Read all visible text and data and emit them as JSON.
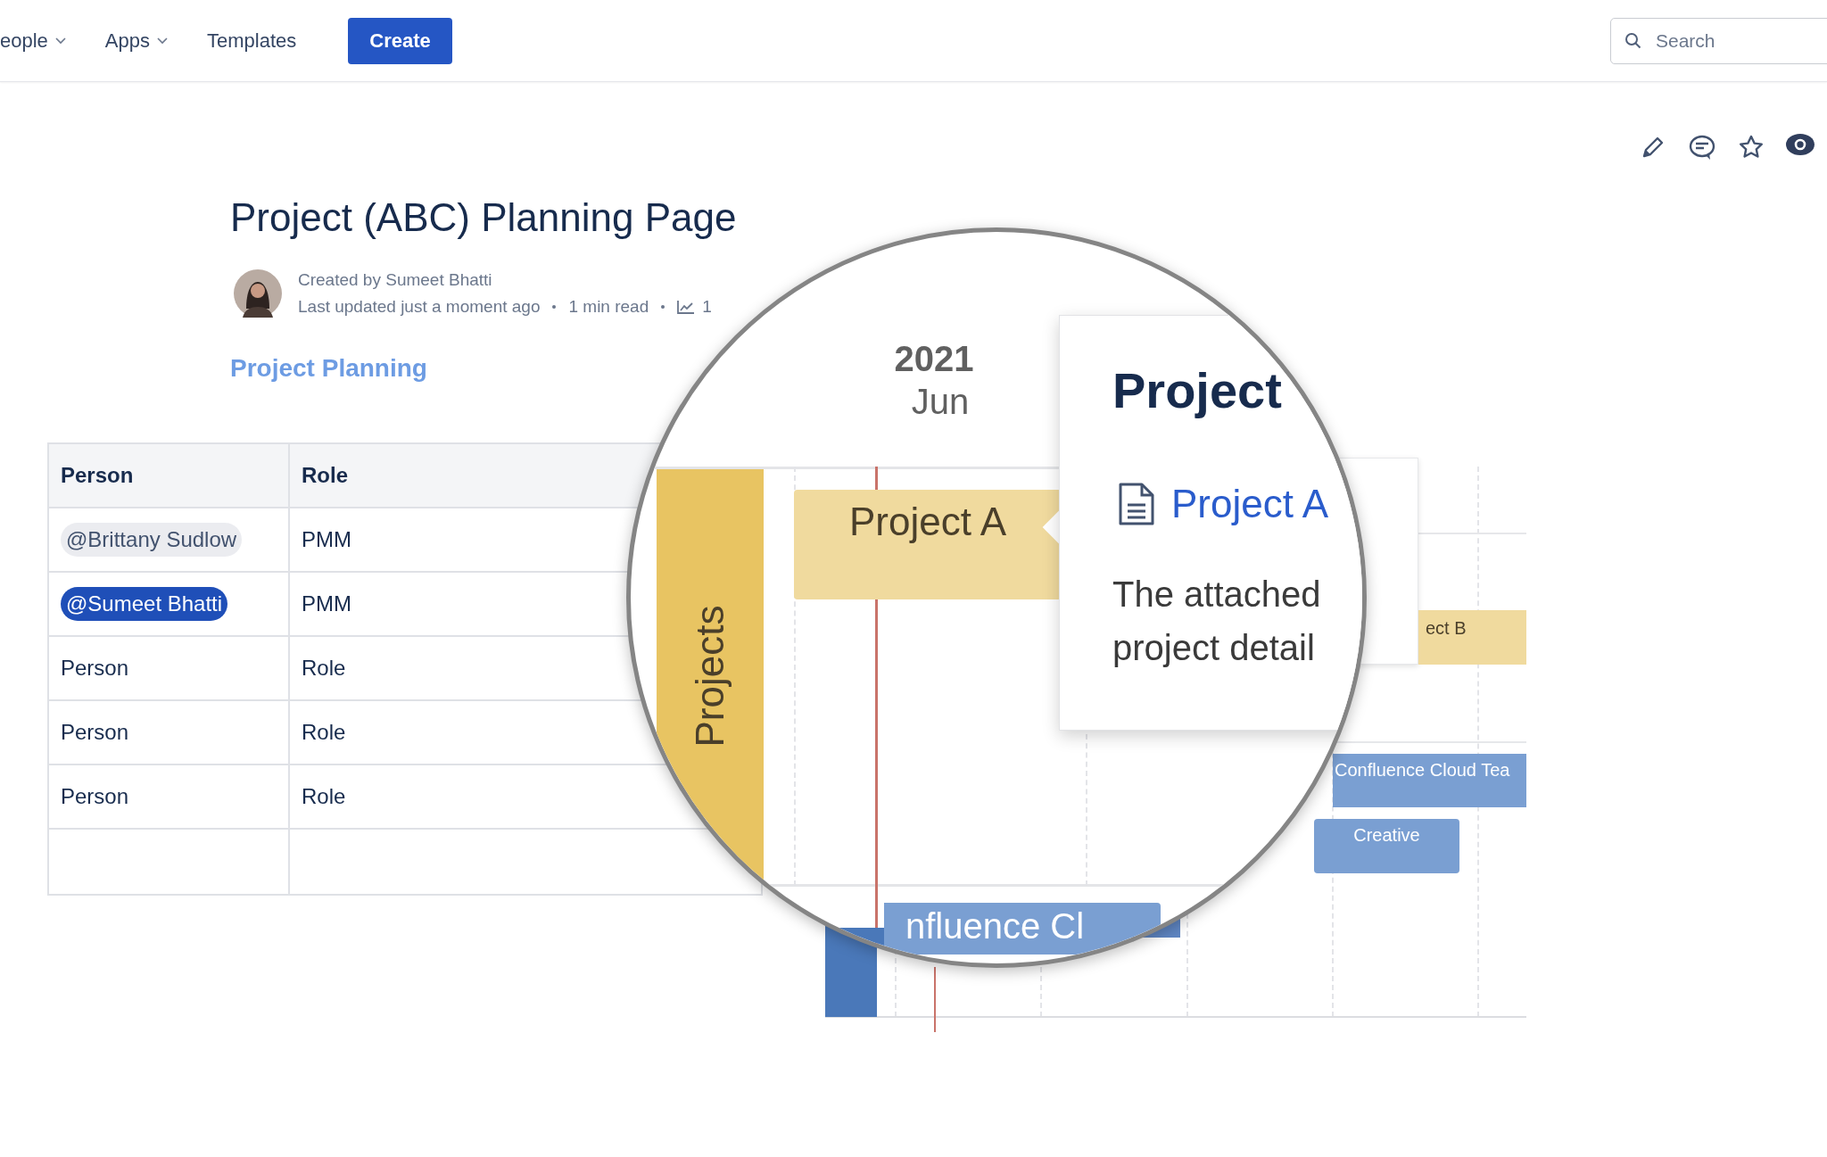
{
  "nav": {
    "items": [
      {
        "label": "eople",
        "dropdown": true
      },
      {
        "label": "Apps",
        "dropdown": true
      },
      {
        "label": "Templates",
        "dropdown": false
      }
    ],
    "create_button": "Create",
    "search": {
      "placeholder": "Search"
    }
  },
  "page": {
    "title": "Project (ABC) Planning Page",
    "byline": "Created by Sumeet Bhatti",
    "meta": [
      "Last updated just a moment ago",
      "1 min read"
    ],
    "views": "1",
    "link": "Project Planning"
  },
  "table": {
    "columns": [
      "Person",
      "Role"
    ],
    "rows": [
      {
        "kind": "mention",
        "highlighted": false,
        "cells": [
          "@Brittany Sudlow",
          "PMM"
        ]
      },
      {
        "kind": "mention",
        "highlighted": true,
        "cells": [
          "@Sumeet Bhatti",
          "PMM"
        ]
      },
      {
        "kind": "text",
        "cells": [
          "Person",
          "Role"
        ]
      },
      {
        "kind": "text",
        "cells": [
          "Person",
          "Role"
        ]
      },
      {
        "kind": "text",
        "cells": [
          "Person",
          "Role"
        ]
      },
      {
        "kind": "empty"
      }
    ]
  },
  "timeline": {
    "bars": [
      {
        "label": "ect B",
        "color": "#f0da9e"
      },
      {
        "label": "Confluence Cloud Tea",
        "color": "#7a9fd2"
      },
      {
        "label": "Creative",
        "color": "#7a9fd2"
      }
    ]
  },
  "magnifier": {
    "year": "2021",
    "month": "Jun",
    "lane": "Projects",
    "bars": [
      {
        "label": "Project A",
        "color": "#f0da9e"
      },
      {
        "label": "nfluence Cl",
        "color": "#7a9fd2"
      }
    ],
    "popup": {
      "title": "Project",
      "link": "Project A",
      "description": "The attached project detail"
    }
  }
}
